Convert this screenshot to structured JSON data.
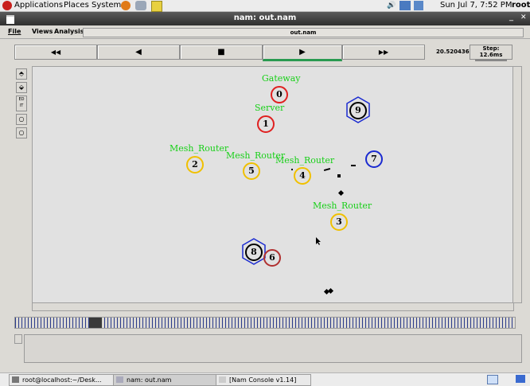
{
  "top_panel": {
    "menu": [
      "Applications",
      "Places",
      "System"
    ],
    "datetime": "Sun Jul 7, 7:52 PM",
    "user": "root"
  },
  "window": {
    "title": "nam: out.nam",
    "menus": [
      "File",
      "Views",
      "Analysis"
    ],
    "file_label": "out.nam",
    "time_value": "20.520436",
    "step_label": "Step: 12.6ms",
    "transport": {
      "rewind": "◀◀",
      "back": "◀",
      "stop": "■",
      "play": "▶",
      "ff": "▶▶"
    }
  },
  "nodes": [
    {
      "id": "0",
      "label": "Gateway",
      "color": "#e02020"
    },
    {
      "id": "1",
      "label": "Server",
      "color": "#e02020"
    },
    {
      "id": "2",
      "label": "Mesh_Router",
      "color": "#f0c000"
    },
    {
      "id": "3",
      "label": "Mesh_Router",
      "color": "#f0c000"
    },
    {
      "id": "4",
      "label": "Mesh_Router",
      "color": "#f0c000"
    },
    {
      "id": "5",
      "label": "Mesh_Router",
      "color": "#f0c000"
    },
    {
      "id": "6",
      "label": "",
      "color": "#b03030"
    },
    {
      "id": "7",
      "label": "",
      "color": "#1a2ad0"
    },
    {
      "id": "8",
      "label": "",
      "color": "#000000"
    },
    {
      "id": "9",
      "label": "",
      "color": "#000000"
    }
  ],
  "taskbar": {
    "items": [
      "root@localhost:~/Desk...",
      "nam: out.nam",
      "[Nam Console v1.14]"
    ]
  }
}
